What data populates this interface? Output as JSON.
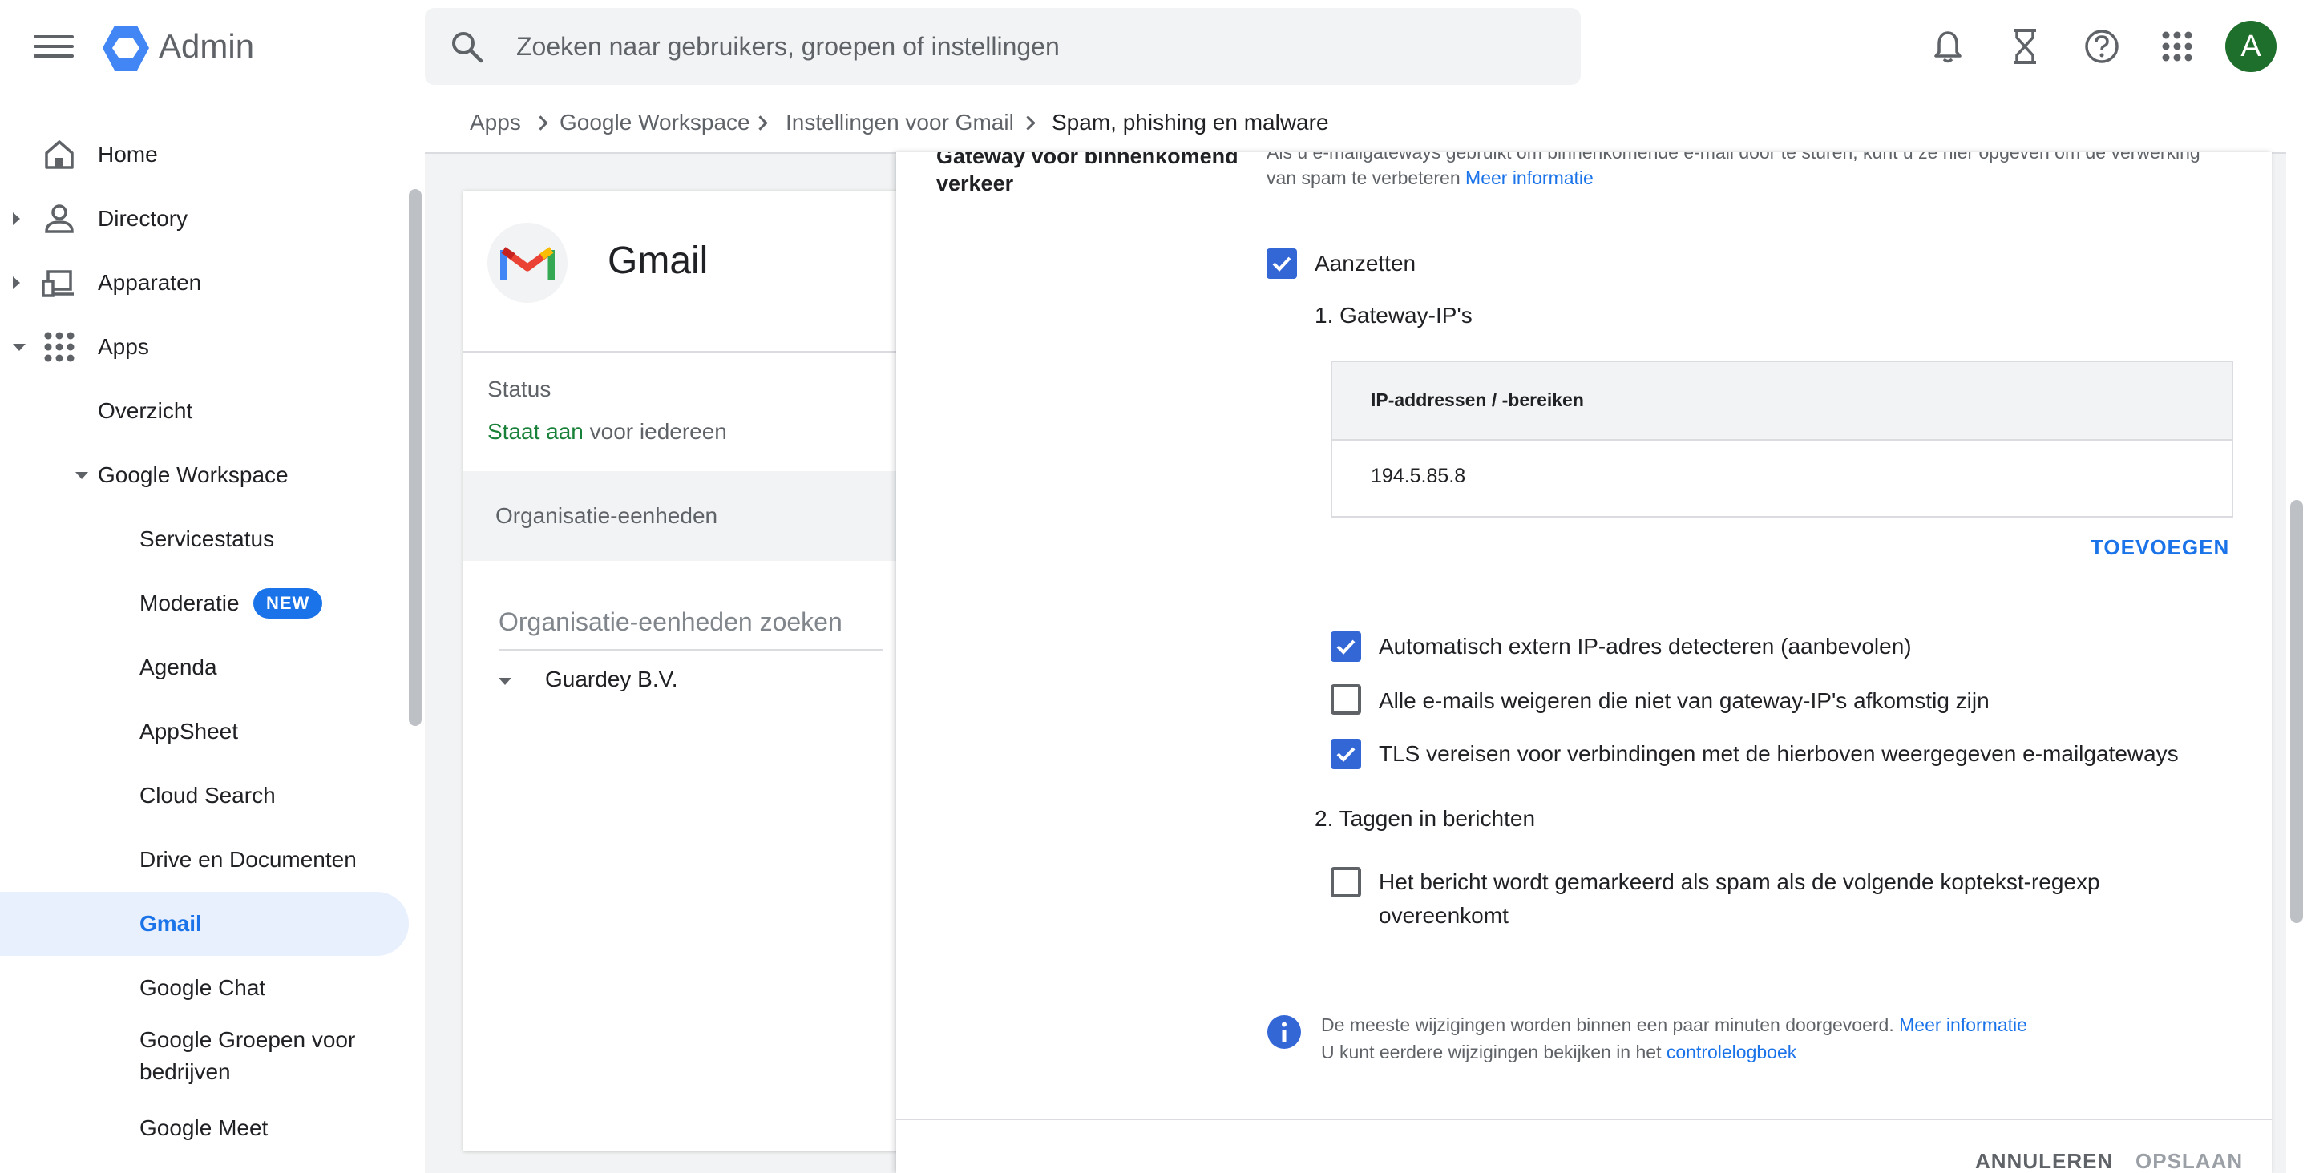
{
  "header": {
    "app_title": "Admin",
    "search_placeholder": "Zoeken naar gebruikers, groepen of instellingen",
    "avatar_initial": "A",
    "icons": [
      "menu-icon",
      "admin-logo",
      "search-icon",
      "bell-icon",
      "hourglass-icon",
      "help-icon",
      "apps-grid-icon"
    ]
  },
  "sidebar": {
    "items": [
      {
        "label": "Home",
        "icon": "home-icon"
      },
      {
        "label": "Directory",
        "icon": "person-icon"
      },
      {
        "label": "Apparaten",
        "icon": "devices-icon"
      },
      {
        "label": "Apps",
        "icon": "apps-icon"
      },
      {
        "label": "Overzicht"
      },
      {
        "label": "Google Workspace"
      },
      {
        "label": "Servicestatus"
      },
      {
        "label": "Moderatie",
        "badge": "NEW"
      },
      {
        "label": "Agenda"
      },
      {
        "label": "AppSheet"
      },
      {
        "label": "Cloud Search"
      },
      {
        "label": "Drive en Documenten"
      },
      {
        "label": "Gmail",
        "active": true
      },
      {
        "label": "Google Chat"
      },
      {
        "label": "Google Groepen voor bedrijven"
      },
      {
        "label": "Google Meet"
      }
    ]
  },
  "breadcrumb": [
    "Apps",
    "Google Workspace",
    "Instellingen voor Gmail",
    "Spam, phishing en malware"
  ],
  "gmail_card": {
    "title": "Gmail",
    "status_label": "Status",
    "status_on": "Staat aan",
    "status_rest": "voor iedereen",
    "org_units_header": "Organisatie-eenheden",
    "org_search_placeholder": "Organisatie-eenheden zoeken",
    "org_root": "Guardey B.V."
  },
  "panel": {
    "section_title": "Gateway voor binnenkomend verkeer",
    "section_desc": "Als u e-mailgateways gebruikt om binnenkomende e-mail door te sturen, kunt u ze hier opgeven om de verwerking van spam te verbeteren",
    "section_desc_link": "Meer informatie",
    "enable_label": "Aanzetten",
    "enable_checked": true,
    "step1": "1. Gateway-IP's",
    "ip_table": {
      "header": "IP-addressen / -bereiken",
      "rows": [
        "194.5.85.8"
      ]
    },
    "add_button": "TOEVOEGEN",
    "options": [
      {
        "label": "Automatisch extern IP-adres detecteren (aanbevolen)",
        "checked": true
      },
      {
        "label": "Alle e-mails weigeren die niet van gateway-IP's afkomstig zijn",
        "checked": false
      },
      {
        "label": "TLS vereisen voor verbindingen met de hierboven weergegeven e-mailgateways",
        "checked": true
      }
    ],
    "step2": "2. Taggen in berichten",
    "tag_option": {
      "label": "Het bericht wordt gemarkeerd als spam als de volgende koptekst-regexp overeenkomt",
      "checked": false
    },
    "info_line1": "De meeste wijzigingen worden binnen een paar minuten doorgevoerd.",
    "info_link1": "Meer informatie",
    "info_line2": "U kunt eerdere wijzigingen bekijken in het",
    "info_link2": "controlelogboek",
    "cancel_button": "ANNULEREN",
    "save_button": "OPSLAAN"
  },
  "colors": {
    "accent": "#1a73e8",
    "checkbox": "#3367d6",
    "status_green": "#188038",
    "avatar": "#1e6e2c"
  }
}
